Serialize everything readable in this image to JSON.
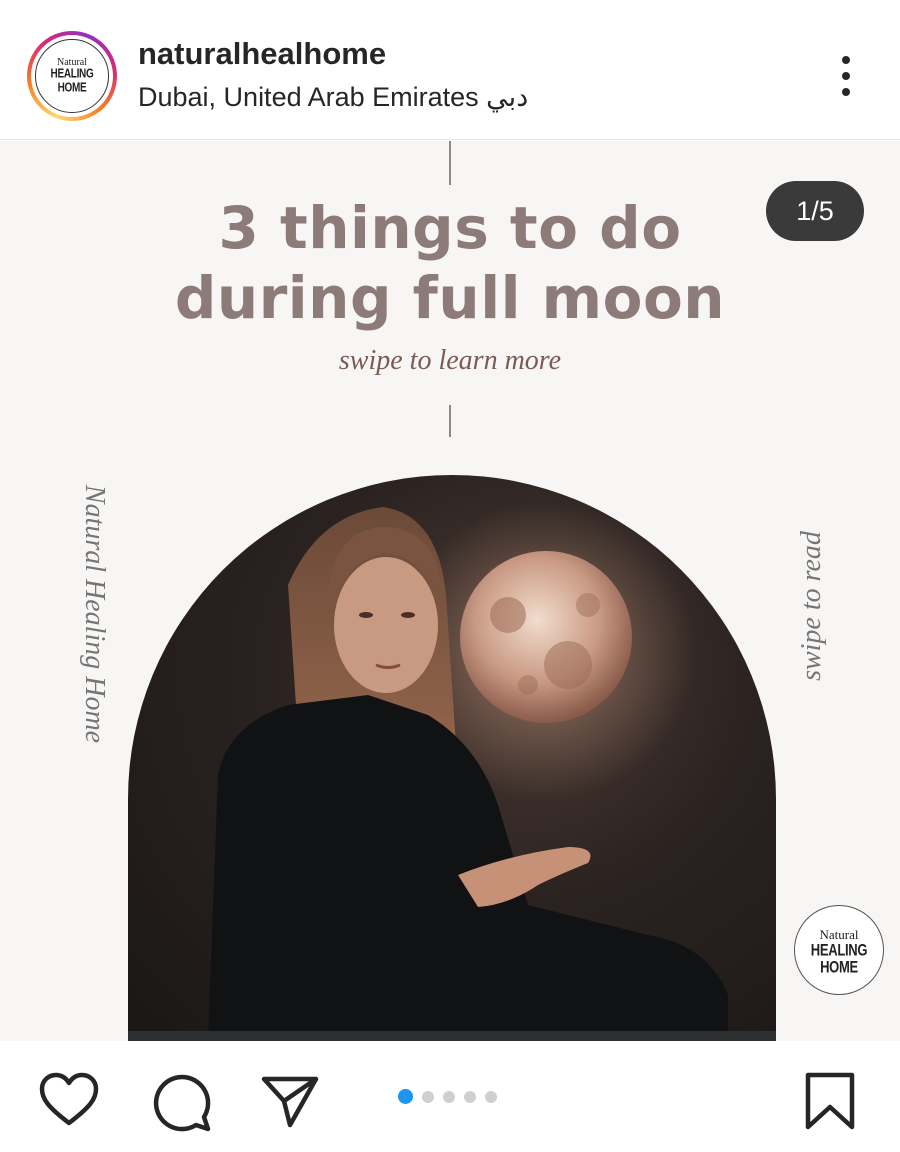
{
  "header": {
    "username": "naturalhealhome",
    "location": "Dubai, United Arab Emirates دبي",
    "avatar": {
      "logo_line1": "Natural",
      "logo_line2": "HEALING",
      "logo_line3": "HOME"
    },
    "more_icon": "more-vertical-icon"
  },
  "post": {
    "title": "3 things to do during full moon",
    "subtitle": "swipe to learn more",
    "counter": "1/5",
    "side_left": "Natural Healing Home",
    "side_right": "swipe to read",
    "stamp": {
      "line1": "Natural",
      "line2": "HEALING",
      "line3": "HOME"
    },
    "colors": {
      "title": "#8c7b78",
      "subtitle": "#7a5c55",
      "background": "#f7f6f5"
    }
  },
  "actions": {
    "icons": [
      "heart-icon",
      "comment-icon",
      "share-icon",
      "bookmark-icon"
    ],
    "carousel": {
      "total": 5,
      "active": 1,
      "active_color": "#1b95f0"
    }
  }
}
